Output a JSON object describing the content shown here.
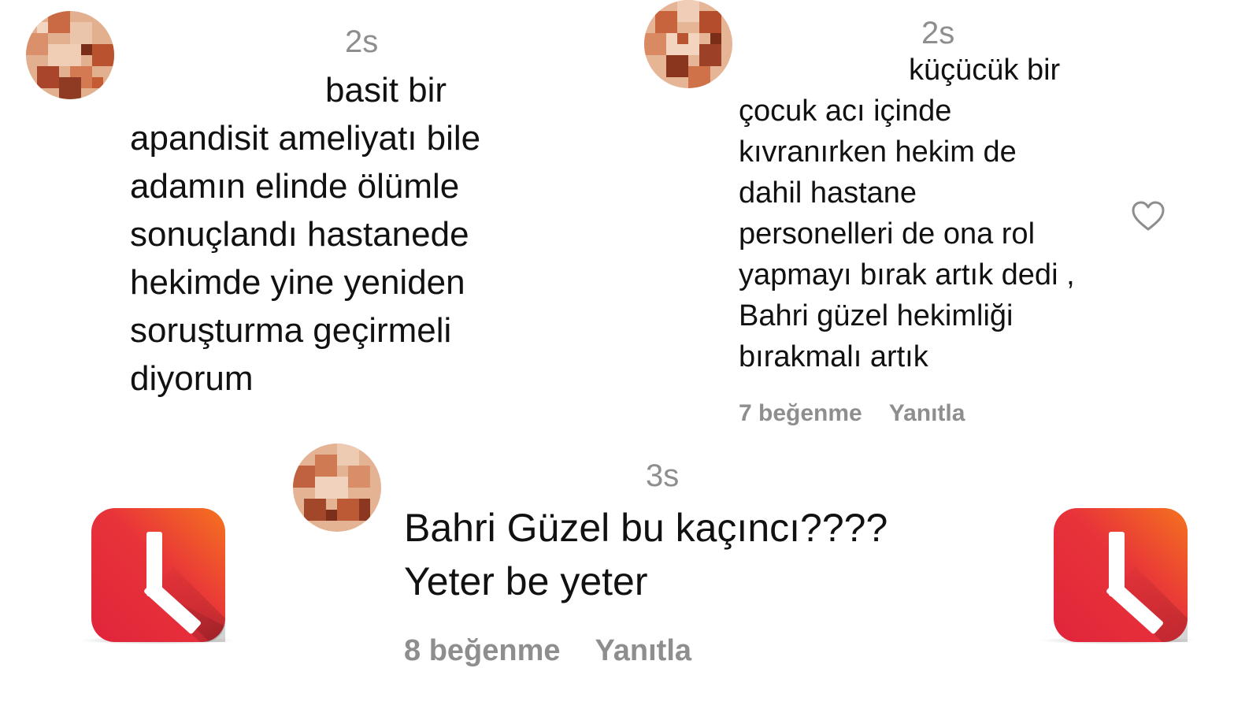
{
  "comments": [
    {
      "time": "2s",
      "text": "basit bir\napandisit ameliyatı bile\nadamın elinde ölümle\nsonuçlandı hastanede\nhekimde yine yeniden\nsoruşturma geçirmeli\ndiyorum"
    },
    {
      "time": "2s",
      "text": "küçücük bir\nçocuk acı içinde\nkıvranırken hekim de\ndahil hastane\npersonelleri de ona rol\nyapmayı bırak artık dedi ,\nBahri güzel hekimliği\nbırakmalı artık",
      "likes": "7 beğenme",
      "reply_label": "Yanıtla",
      "like_icon": "heart-outline-icon"
    },
    {
      "time": "3s",
      "text": "Bahri Güzel bu kaçıncı????\nYeter be yeter",
      "likes": "8 beğenme",
      "reply_label": "Yanıtla"
    }
  ],
  "logo": {
    "icon": "clock-icon",
    "gradient_start": "#e0243b",
    "gradient_end": "#f5731f",
    "hands_color": "#ffffff"
  },
  "colors": {
    "meta_gray": "#8e8e8e",
    "text": "#111111"
  }
}
